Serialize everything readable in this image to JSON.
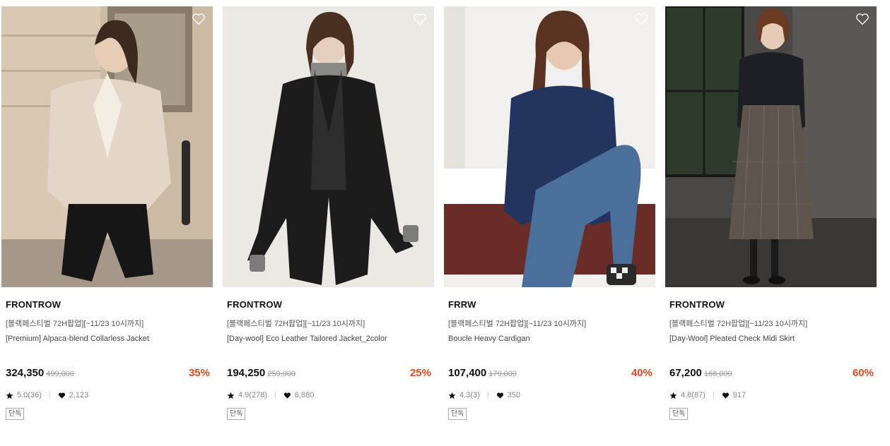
{
  "products": [
    {
      "brand": "FRONTROW",
      "promo": "[블랙페스티벌 72H팝업][~11/23 10시까지]",
      "name": "[Premium] Alpaca-blend Collarless Jacket",
      "price": "324,350",
      "original_price": "499,000",
      "discount": "35%",
      "rating": "5.0(36)",
      "likes": "2,123",
      "badge": "단독"
    },
    {
      "brand": "FRONTROW",
      "promo": "[블랙페스티벌 72H팝업][~11/23 10시까지]",
      "name": "[Day-wool] Eco Leather Tailored Jacket_2color",
      "price": "194,250",
      "original_price": "259,000",
      "discount": "25%",
      "rating": "4.9(278)",
      "likes": "6,880",
      "badge": "단독"
    },
    {
      "brand": "FRRW",
      "promo": "[블랙페스티벌 72H팝업][~11/23 10시까지]",
      "name": "Boucle Heavy Cardigan",
      "price": "107,400",
      "original_price": "179,000",
      "discount": "40%",
      "rating": "4.3(3)",
      "likes": "350",
      "badge": "단독"
    },
    {
      "brand": "FRONTROW",
      "promo": "[블랙페스티벌 72H팝업][~11/23 10시까지]",
      "name": "[Day-Wool] Pleated Check Midi Skirt",
      "price": "67,200",
      "original_price": "168,000",
      "discount": "60%",
      "rating": "4.8(87)",
      "likes": "917",
      "badge": "단독"
    }
  ],
  "colors": {
    "discount": "#e8471c",
    "text": "#111111",
    "muted": "#888888"
  },
  "icons": {
    "wishlist": "heart-outline-icon",
    "rating": "star-icon",
    "likes": "heart-filled-icon"
  }
}
